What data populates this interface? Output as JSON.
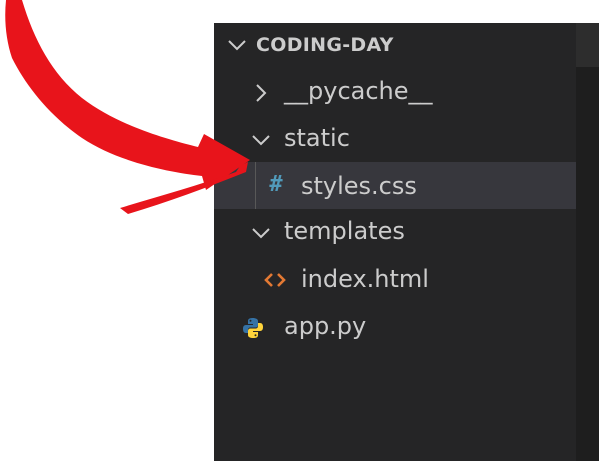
{
  "explorer": {
    "project_name": "CODING-DAY",
    "items": [
      {
        "label": "__pycache__",
        "type": "folder",
        "expanded": false,
        "depth": 1
      },
      {
        "label": "static",
        "type": "folder",
        "expanded": true,
        "depth": 1
      },
      {
        "label": "styles.css",
        "type": "file",
        "icon": "css-hash-icon",
        "selected": true,
        "depth": 2
      },
      {
        "label": "templates",
        "type": "folder",
        "expanded": true,
        "depth": 1
      },
      {
        "label": "index.html",
        "type": "file",
        "icon": "html-brackets-icon",
        "depth": 2
      },
      {
        "label": "app.py",
        "type": "file",
        "icon": "python-icon",
        "depth": 1
      }
    ]
  },
  "colors": {
    "sidebar_bg": "#252526",
    "selected_bg": "#37373d",
    "text": "#cccccc",
    "css_icon": "#519aba",
    "html_icon": "#e37933",
    "python_blue": "#3572a5",
    "python_yellow": "#ffd43b",
    "annotation_arrow": "#e8141b"
  },
  "annotation": {
    "icon": "red-curved-arrow",
    "points_to": "styles.css"
  }
}
